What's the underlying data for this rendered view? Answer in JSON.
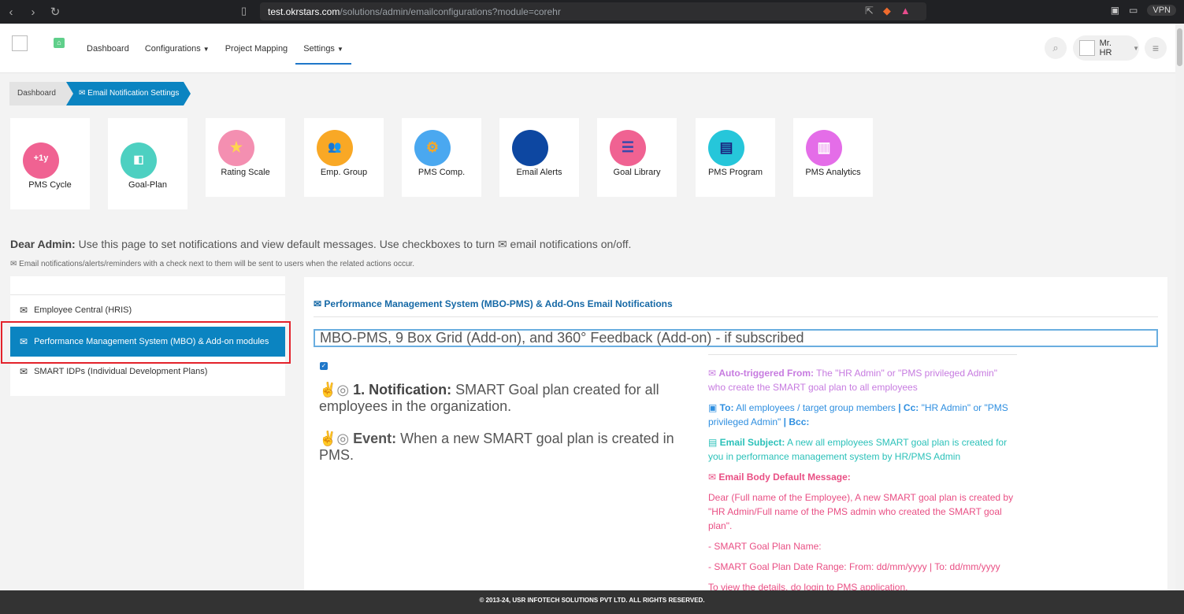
{
  "browser": {
    "url_host": "test.okrstars.com",
    "url_path": "/solutions/admin/emailconfigurations?module=corehr",
    "vpn_label": "VPN"
  },
  "header": {
    "menu": [
      {
        "label": "Dashboard"
      },
      {
        "label": "Configurations",
        "has_caret": true
      },
      {
        "label": "Project Mapping"
      },
      {
        "label": "Settings",
        "has_caret": true,
        "active": true
      }
    ],
    "user_name": "Mr. HR"
  },
  "breadcrumb": {
    "home": "Dashboard",
    "current": "Email Notification Settings"
  },
  "tiles": [
    {
      "label": "PMS Cycle",
      "color": "#f06292",
      "glyph": "+1y"
    },
    {
      "label": "Goal-Plan",
      "color": "#4dd0c1",
      "glyph": "◧"
    },
    {
      "label": "Rating Scale",
      "color": "#f48fb1",
      "glyph": "★"
    },
    {
      "label": "Emp. Group",
      "color": "#f9a825",
      "glyph": "👥"
    },
    {
      "label": "PMS Comp.",
      "color": "#4aa8f0",
      "glyph": "⚙"
    },
    {
      "label": "Email Alerts",
      "color": "#0d47a1",
      "glyph": ""
    },
    {
      "label": "Goal Library",
      "color": "#f06292",
      "glyph": "☰"
    },
    {
      "label": "PMS Program",
      "color": "#26c6da",
      "glyph": "▤"
    },
    {
      "label": "PMS Analytics",
      "color": "#e46de8",
      "glyph": "▥"
    }
  ],
  "intro": {
    "lead": "Dear Admin:",
    "text_before": "Use this page to set notifications and view default messages. Use checkboxes to turn",
    "text_after": "email notifications on/off.",
    "sub": "Email notifications/alerts/reminders with a check next to them will be sent to users when the related actions occur."
  },
  "sidebar": {
    "items": [
      {
        "label": "Employee Central (HRIS)"
      },
      {
        "label": "Performance Management System (MBO) & Add-on modules",
        "active": true
      },
      {
        "label": "SMART IDPs (Individual Development Plans)"
      }
    ]
  },
  "panel": {
    "title": "Performance Management System (MBO-PMS) & Add-Ons Email Notifications",
    "input_value": "MBO-PMS, 9 Box Grid (Add-on), and 360° Feedback (Add-on) - if subscribed",
    "notification_label": "1. Notification:",
    "notification_text": "SMART Goal plan created for all employees in the organization.",
    "event_label": "Event:",
    "event_text": "When a new SMART goal plan is created in PMS.",
    "auto_label": "Auto-triggered From:",
    "auto_text": "The \"HR Admin\" or \"PMS privileged Admin\" who create the SMART goal plan to all employees",
    "to_label": "To:",
    "to_text": "All employees / target group members",
    "cc_label": "| Cc:",
    "cc_text": "\"HR Admin\" or \"PMS privileged Admin\"",
    "bcc_label": "| Bcc:",
    "subject_label": "Email Subject:",
    "subject_text": "A new all employees SMART goal plan is created for you in performance management system by HR/PMS Admin",
    "body_label": "Email Body Default Message:",
    "body_1": "Dear (Full name of the Employee), A new SMART goal plan is created by \"HR Admin/Full name of the PMS admin who created the SMART goal plan\".",
    "body_2": "- SMART Goal Plan Name:",
    "body_3": "- SMART Goal Plan Date Range: From: dd/mm/yyyy | To: dd/mm/yyyy",
    "body_4": "To view the details, do login to PMS application."
  },
  "footer": {
    "text": "© 2013-24, USR INFOTECH SOLUTIONS PVT LTD. ALL RIGHTS RESERVED."
  }
}
